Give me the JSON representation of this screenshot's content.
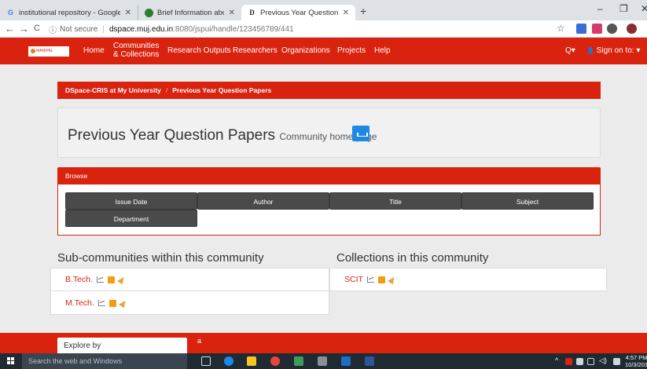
{
  "browser": {
    "tabs": [
      {
        "title": "institutional repository - Google",
        "favicon": "google-icon"
      },
      {
        "title": "Brief Information about Institutio",
        "favicon": "cloud-icon"
      },
      {
        "title": "Previous Year Question Papers | D",
        "favicon": "dspace-icon",
        "active": true
      }
    ],
    "new_tab": "+",
    "window": {
      "minimize": "–",
      "maximize": "❐",
      "close": "✕"
    },
    "nav": {
      "back": "←",
      "forward": "→",
      "reload": "C"
    },
    "address": {
      "info_icon": "ⓘ",
      "security_label": "Not secure",
      "separator": "|",
      "host": "dspace.muj.edu.in",
      "path": ":8080/jspui/handle/123456789/441"
    },
    "bookmark_star": "☆"
  },
  "navbar": {
    "logo_text": "MANIPAL UNIVERSITY",
    "home": "Home",
    "communities_line1": "Communities",
    "communities_line2": "& Collections",
    "research_outputs": "Research Outputs",
    "researchers": "Researchers",
    "organizations": "Organizations",
    "projects": "Projects",
    "help": "Help",
    "search": "Q▾",
    "signin": "Sign on to: ▾",
    "signin_icon": "👤"
  },
  "breadcrumb": {
    "root": "DSpace-CRIS at My University",
    "separator": "/",
    "current": "Previous Year Question Papers"
  },
  "page": {
    "title": "Previous Year Question Papers",
    "subtitle": "Community home page"
  },
  "browse": {
    "heading": "Browse",
    "buttons": [
      "Issue Date",
      "Author",
      "Title",
      "Subject",
      "Department"
    ]
  },
  "subcommunities": {
    "heading": "Sub-communities within this community",
    "items": [
      "B.Tech.",
      "M.Tech."
    ]
  },
  "collections": {
    "heading": "Collections in this community",
    "items": [
      "SCIT"
    ]
  },
  "footer": {
    "explore_label": "Explore by",
    "side_text": "a"
  },
  "taskbar": {
    "search_placeholder": "Search the web and Windows",
    "time": "4:57 PM",
    "date": "10/3/201"
  },
  "colors": {
    "brand_red": "#d9230f",
    "browse_button": "#4a4a4a",
    "stats_button": "#1e88e5",
    "background": "#ebebeb"
  }
}
